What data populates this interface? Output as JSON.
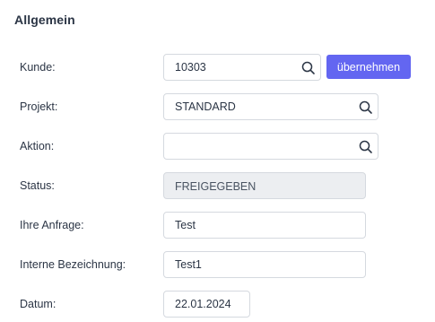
{
  "section": {
    "title": "Allgemein"
  },
  "fields": {
    "kunde": {
      "label": "Kunde:",
      "value": "10303",
      "icon": "search-icon"
    },
    "projekt": {
      "label": "Projekt:",
      "value": "STANDARD",
      "icon": "search-icon"
    },
    "aktion": {
      "label": "Aktion:",
      "value": "",
      "icon": "search-icon"
    },
    "status": {
      "label": "Status:",
      "value": "FREIGEGEBEN"
    },
    "anfrage": {
      "label": "Ihre Anfrage:",
      "value": "Test"
    },
    "bezeichnung": {
      "label": "Interne Bezeichnung:",
      "value": "Test1"
    },
    "datum": {
      "label": "Datum:",
      "value": "22.01.2024"
    }
  },
  "buttons": {
    "uebernehmen": "übernehmen"
  },
  "colors": {
    "accent": "#6366f1",
    "readonly_bg": "#eceef1",
    "border": "#d5d9df"
  }
}
